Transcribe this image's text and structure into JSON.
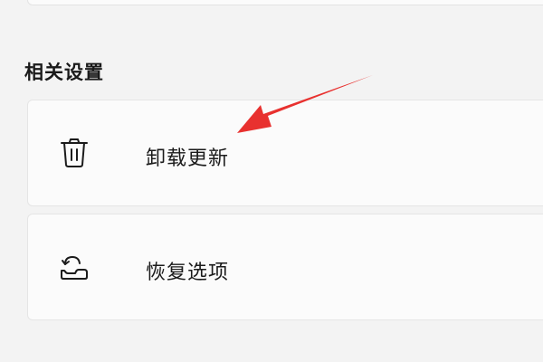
{
  "related_settings": {
    "heading": "相关设置",
    "items": [
      {
        "label": "卸载更新",
        "icon": "trash-icon"
      },
      {
        "label": "恢复选项",
        "icon": "recovery-icon"
      }
    ]
  },
  "annotation": {
    "arrow_color": "#e8312f"
  }
}
